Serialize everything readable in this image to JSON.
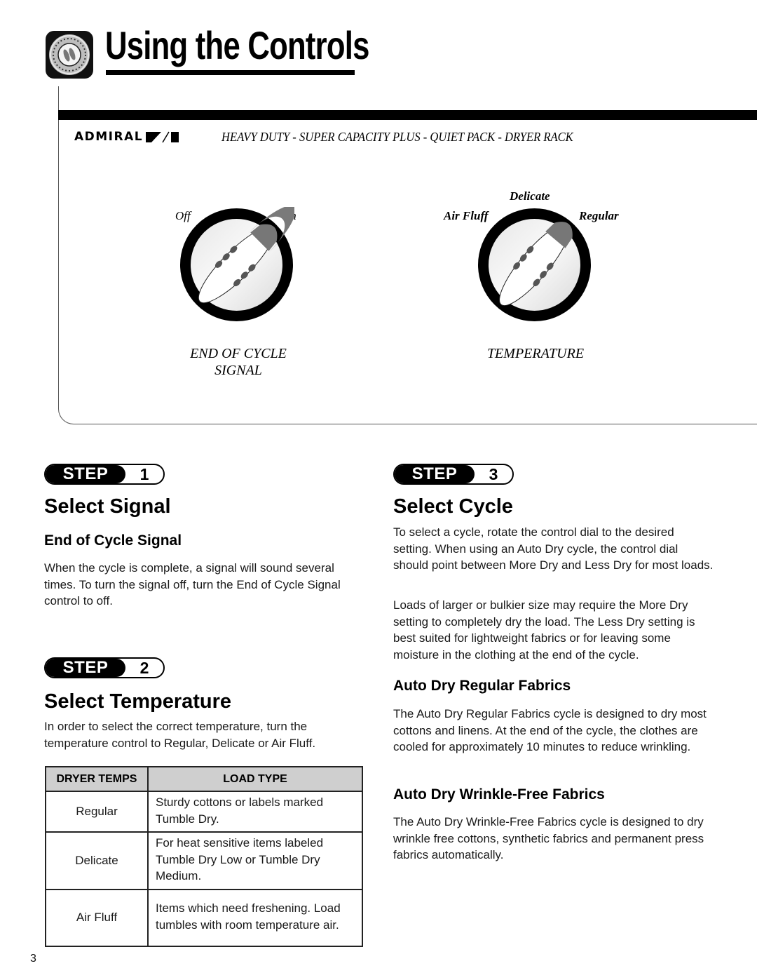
{
  "header": {
    "title": "Using the Controls",
    "logo_icon": "dryer-dial-icon"
  },
  "control_panel": {
    "brand": "ADMIRAL",
    "brand_mark": "admiral-slash-logo",
    "tagline": "HEAVY DUTY - SUPER CAPACITY PLUS - QUIET PACK - DRYER RACK",
    "dials": [
      {
        "caption_line1": "END OF CYCLE",
        "caption_line2": "SIGNAL",
        "positions": [
          "Off",
          "On"
        ]
      },
      {
        "caption_line1": "TEMPERATURE",
        "caption_line2": "",
        "positions": [
          "Air Fluff",
          "Delicate",
          "Regular"
        ]
      }
    ]
  },
  "steps": [
    {
      "step_word": "STEP",
      "number": "1",
      "title": "Select Signal",
      "subheading": "End of Cycle Signal",
      "body": "When the cycle is complete, a signal will sound several times. To turn the signal off, turn the End of Cycle Signal control to off."
    },
    {
      "step_word": "STEP",
      "number": "2",
      "title": "Select Temperature",
      "body": "In order to select the correct temperature, turn the temperature control to Regular, Delicate or Air Fluff.",
      "table": {
        "headers": [
          "DRYER TEMPS",
          "LOAD TYPE"
        ],
        "rows": [
          {
            "temp": "Regular",
            "load": "Sturdy cottons or labels marked Tumble Dry."
          },
          {
            "temp": "Delicate",
            "load": "For heat sensitive items labeled Tumble Dry Low or Tumble Dry Medium."
          },
          {
            "temp": "Air Fluff",
            "load": "Items which need freshening. Load tumbles with room temperature air."
          }
        ]
      }
    },
    {
      "step_word": "STEP",
      "number": "3",
      "title": "Select Cycle",
      "body1": "To select a cycle, rotate the control dial to the desired setting. When using an Auto Dry cycle, the control dial should point between More Dry and Less Dry for most loads.",
      "body2": "Loads of larger or bulkier size may require the More Dry setting to completely dry the load. The Less Dry setting is best suited for lightweight fabrics or for leaving some moisture in the clothing at the end of the cycle.",
      "sections": [
        {
          "heading": "Auto Dry Regular Fabrics",
          "body": "The Auto Dry Regular Fabrics cycle is designed to dry most cottons and linens. At the end of the cycle, the clothes are cooled for approximately 10 minutes to reduce wrinkling."
        },
        {
          "heading": "Auto Dry Wrinkle-Free Fabrics",
          "body": "The Auto Dry Wrinkle-Free Fabrics cycle is designed to dry wrinkle free cottons, synthetic fabrics and permanent press fabrics automatically."
        }
      ]
    }
  ],
  "footer": {
    "page_number": "3"
  }
}
